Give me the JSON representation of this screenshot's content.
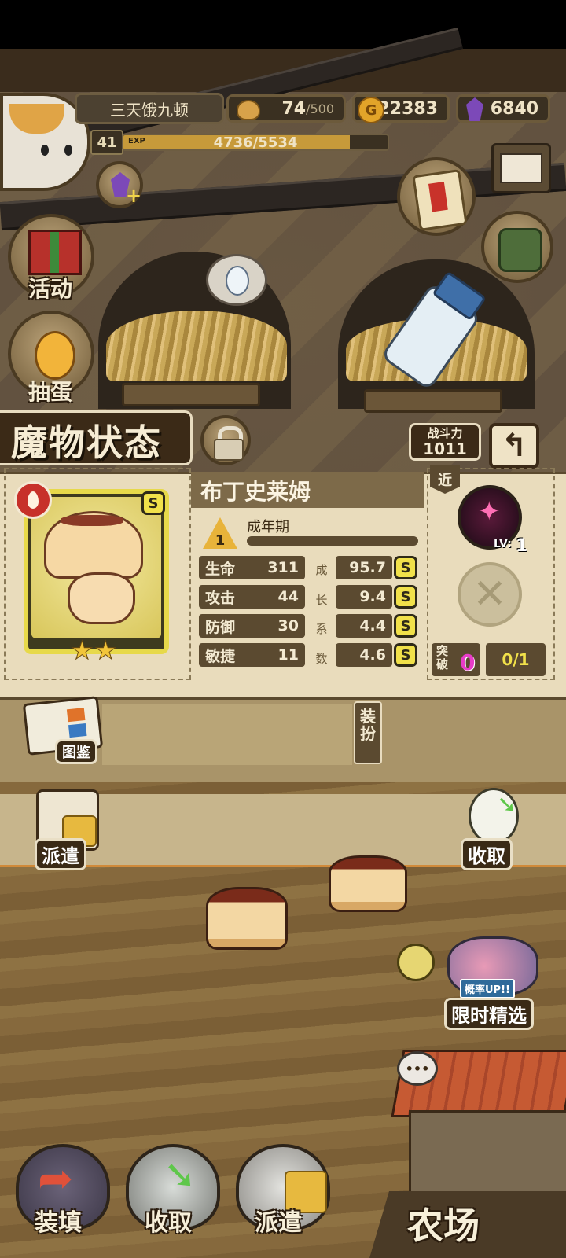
{
  "header": {
    "player_name": "三天饿九顿",
    "level": "41",
    "exp_label": "EXP",
    "exp_text": "4736/5534",
    "exp_fraction": 0.856,
    "stamina_value": "74",
    "stamina_max": "/500",
    "gold": "22383",
    "gold_symbol": "G",
    "gems": "6840"
  },
  "side_buttons": {
    "activity": "活动",
    "gacha": "抽蛋",
    "illustrated": "图鉴",
    "dispatch": "派遣",
    "collect": "收取",
    "limited": "限时精选",
    "limited_tag": "概率UP!!"
  },
  "monster_status": {
    "title": "魔物状态",
    "combat_power_label": "战斗力",
    "combat_power": "1011",
    "monster_name": "布丁史莱姆",
    "rank_badge": "S",
    "stage_number": "1",
    "stage_name": "成年期",
    "stage_progress": 0.0,
    "growth_vertical_label": "成长系数",
    "stats": [
      {
        "label": "生命",
        "value": "311",
        "growth": "95.7",
        "grade": "S"
      },
      {
        "label": "攻击",
        "value": "44",
        "growth": "9.4",
        "grade": "S"
      },
      {
        "label": "防御",
        "value": "30",
        "growth": "4.4",
        "grade": "S"
      },
      {
        "label": "敏捷",
        "value": "11",
        "growth": "4.6",
        "grade": "S"
      }
    ],
    "range_tag": "近",
    "skill_level": "LV:",
    "skill_level_value": "1",
    "breakthrough_label": "突破",
    "breakthrough_count": "0",
    "breakthrough_progress": "0/1",
    "equip_label": "装扮",
    "star_count": 2
  },
  "bottom_nav": {
    "load": "装填",
    "collect": "收取",
    "dispatch": "派遣",
    "farm": "农场"
  },
  "colors": {
    "panel_bg": "#e9dcbc",
    "stat_bg": "#5b4a30",
    "grade_badge": "#f1e14a",
    "breakthrough_count": "#e83cc8"
  }
}
